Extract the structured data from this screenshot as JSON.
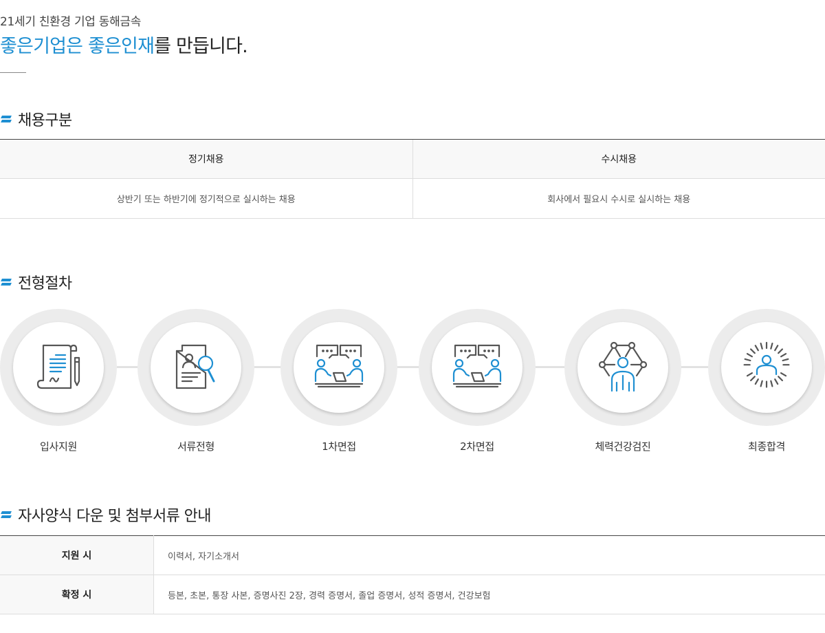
{
  "intro": {
    "subtitle": "21세기 친환경 기업 동해금속",
    "title_highlight": "좋은기업은 좋은인재",
    "title_rest": "를 만듭니다."
  },
  "recruit_types": {
    "heading": "채용구분",
    "columns": [
      {
        "title": "정기채용",
        "desc": "상반기 또는 하반기에 정기적으로 실시하는 채용"
      },
      {
        "title": "수시채용",
        "desc": "회사에서 필요시 수시로 실시하는 채용"
      }
    ]
  },
  "process": {
    "heading": "전형절차",
    "steps": [
      {
        "label": "입사지원",
        "icon": "document-pen-icon"
      },
      {
        "label": "서류전형",
        "icon": "resume-search-icon"
      },
      {
        "label": "1차면접",
        "icon": "interview-icon"
      },
      {
        "label": "2차면접",
        "icon": "interview-icon"
      },
      {
        "label": "체력건강검진",
        "icon": "health-network-icon"
      },
      {
        "label": "최종합격",
        "icon": "success-person-icon"
      }
    ]
  },
  "documents": {
    "heading": "자사양식 다운 및 첨부서류 안내",
    "rows": [
      {
        "label": "지원 시",
        "value": "이력서, 자기소개서"
      },
      {
        "label": "확정 시",
        "value": "등본, 초본, 통장 사본, 증명사진 2장, 경력 증명서, 졸업 증명서, 성적 증명서, 건강보험"
      }
    ]
  },
  "colors": {
    "accent": "#1e8fd2",
    "icon_gray": "#555555"
  }
}
